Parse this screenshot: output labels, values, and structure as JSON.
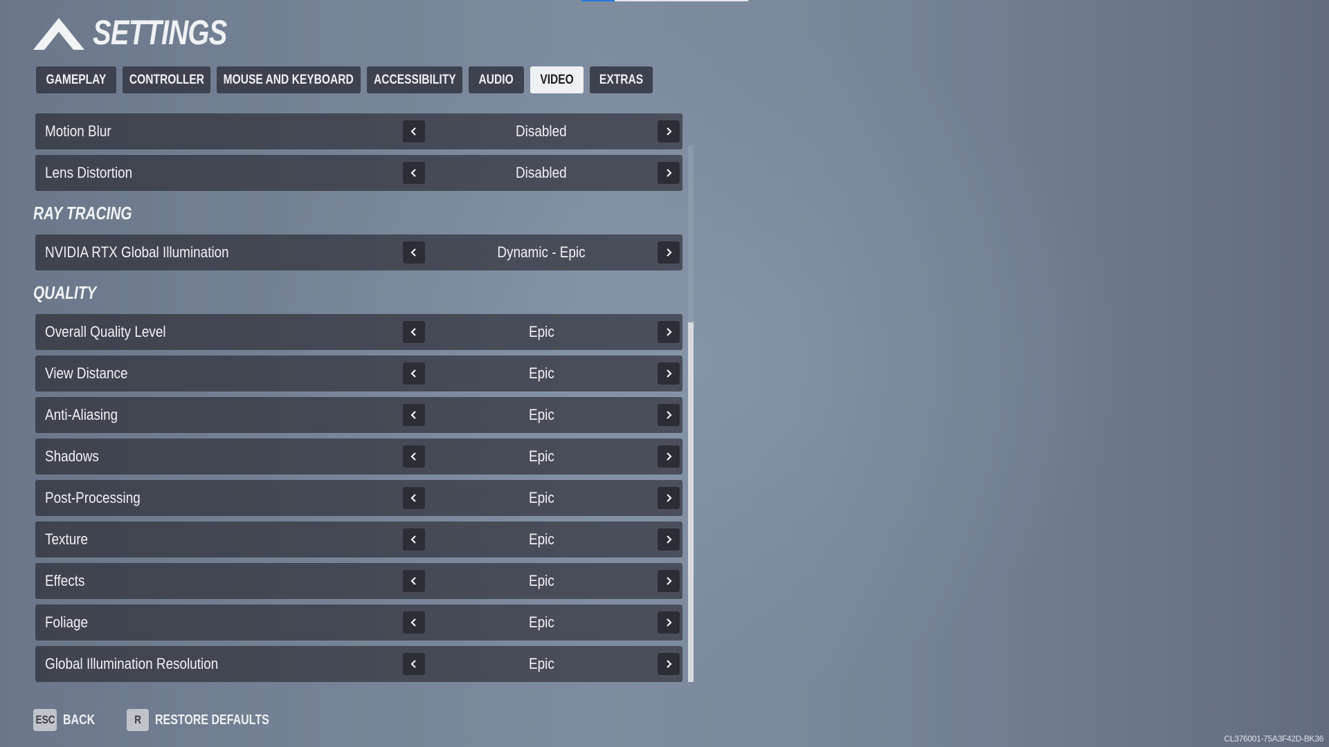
{
  "header": {
    "title": "SETTINGS",
    "logo_icon": "game-logo-icon"
  },
  "top_indicator": {
    "progress": 0.2
  },
  "tabs": [
    {
      "label": "GAMEPLAY",
      "active": false
    },
    {
      "label": "CONTROLLER",
      "active": false
    },
    {
      "label": "MOUSE AND KEYBOARD",
      "active": false
    },
    {
      "label": "ACCESSIBILITY",
      "active": false
    },
    {
      "label": "AUDIO",
      "active": false
    },
    {
      "label": "VIDEO",
      "active": true
    },
    {
      "label": "EXTRAS",
      "active": false
    }
  ],
  "settings": {
    "general": [
      {
        "label": "Motion Blur",
        "value": "Disabled"
      },
      {
        "label": "Lens Distortion",
        "value": "Disabled"
      }
    ],
    "ray_tracing": {
      "heading": "RAY TRACING",
      "items": [
        {
          "label": "NVIDIA RTX Global Illumination",
          "value": "Dynamic - Epic"
        }
      ]
    },
    "quality": {
      "heading": "QUALITY",
      "items": [
        {
          "label": "Overall Quality Level",
          "value": "Epic"
        },
        {
          "label": "View Distance",
          "value": "Epic"
        },
        {
          "label": "Anti-Aliasing",
          "value": "Epic"
        },
        {
          "label": "Shadows",
          "value": "Epic"
        },
        {
          "label": "Post-Processing",
          "value": "Epic"
        },
        {
          "label": "Texture",
          "value": "Epic"
        },
        {
          "label": "Effects",
          "value": "Epic"
        },
        {
          "label": "Foliage",
          "value": "Epic"
        },
        {
          "label": "Global Illumination Resolution",
          "value": "Epic"
        }
      ]
    }
  },
  "arrows": {
    "left_icon": "chevron-left-icon",
    "right_icon": "chevron-right-icon"
  },
  "scrollbar": {
    "position": "bottom",
    "visible_fraction": 0.67
  },
  "footer": {
    "back": {
      "key": "ESC",
      "label": "BACK"
    },
    "restore": {
      "key": "R",
      "label": "RESTORE DEFAULTS"
    }
  },
  "build_id": "CL376001-75A3F42D-BK36",
  "colors": {
    "tab_active_bg": "#eff0f3",
    "tab_bg": "#3e424e",
    "row_bg": "#444955",
    "arrow_bg": "#2c2e36",
    "accent_blue": "#1f7ae0"
  }
}
